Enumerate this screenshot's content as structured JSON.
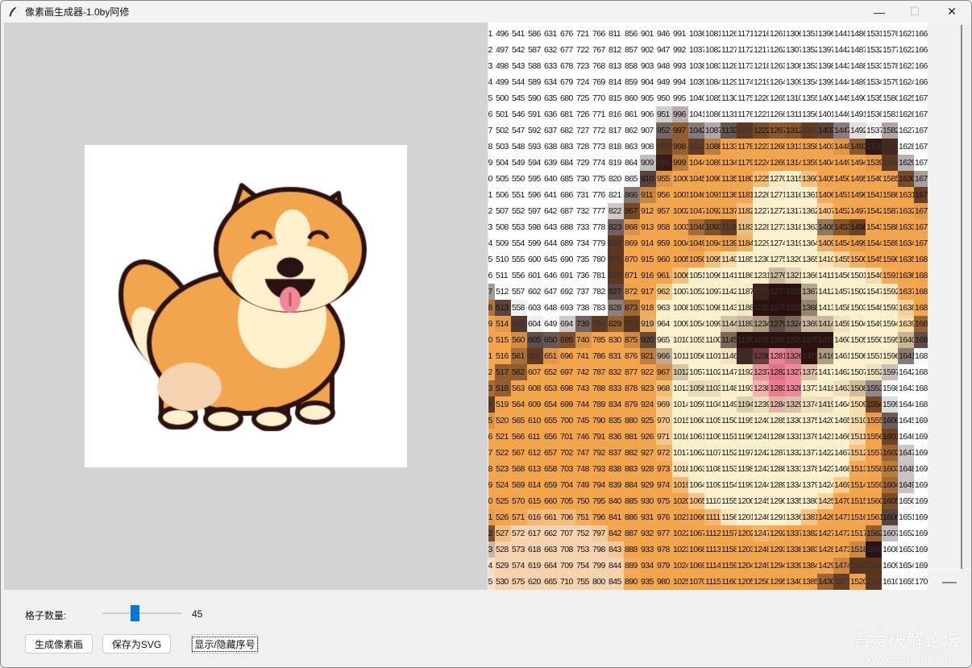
{
  "window": {
    "title": "像素画生成器-1.0by阿修",
    "controls": {
      "minimize": "—",
      "maximize": "☐",
      "close": "✕"
    }
  },
  "grid": {
    "size": 45,
    "first_visible_col": 10,
    "visible_cols": 28,
    "first_visible_row": 0,
    "visible_rows": 35
  },
  "controls": {
    "grid_label": "格子数量:",
    "grid_value": "45",
    "slider_fraction": 0.4,
    "generate_label": "生成像素画",
    "save_label": "保存为SVG",
    "toggle_label": "显示/隐藏序号"
  },
  "watermark": {
    "line1": "吾爱破解论坛",
    "line2": "www.52pojie.cn"
  },
  "colors": {
    "accent": "#0078d7",
    "outline": "#2b1210",
    "orange": "#f3a54e",
    "cream": "#fdf0cc"
  }
}
